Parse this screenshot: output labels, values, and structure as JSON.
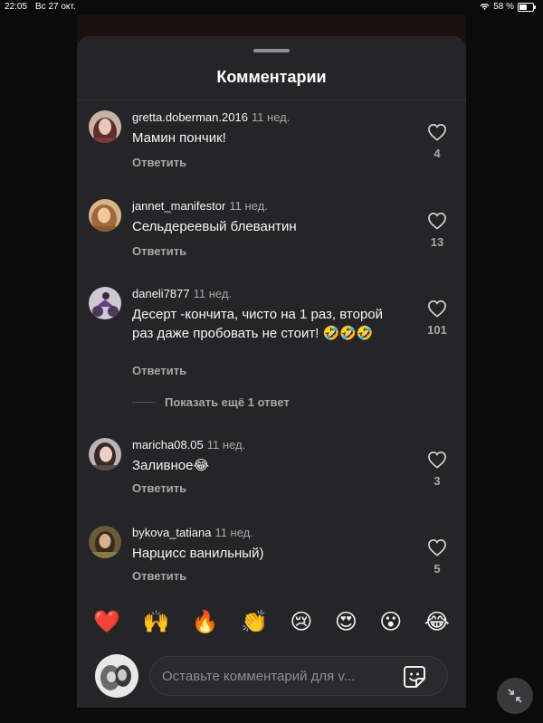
{
  "status_bar": {
    "time": "22:05",
    "date": "Вс 27 окт.",
    "battery": "58 %",
    "battery_level": 0.58
  },
  "sheet": {
    "title": "Комментарии"
  },
  "comments": [
    {
      "user": "gretta.doberman.2016",
      "time": "11 нед.",
      "text": "Мамин  пончик!",
      "reply_label": "Ответить",
      "likes": "4"
    },
    {
      "user": "jannet_manifestor",
      "time": "11 нед.",
      "text": "Сельдереевый блевантин",
      "reply_label": "Ответить",
      "likes": "13"
    },
    {
      "user": "daneli7877",
      "time": "11 нед.",
      "text": "Десерт -кончита, чисто на 1 раз, второй раз даже пробовать не стоит! 🤣🤣🤣",
      "reply_label": "Ответить",
      "likes": "101"
    },
    {
      "user": "maricha08.05",
      "time": "11 нед.",
      "text": "Заливное😂",
      "reply_label": "Ответить",
      "likes": "3"
    },
    {
      "user": "bykova_tatiana",
      "time": "11 нед.",
      "text": "Нарцисс ванильный)",
      "reply_label": "Ответить",
      "likes": "5"
    }
  ],
  "more_replies_label": "Показать ещё 1 ответ",
  "emoji_bar": [
    "❤️",
    "🙌",
    "🔥",
    "👏",
    "😢",
    "😍",
    "😮",
    "😂"
  ],
  "composer": {
    "placeholder": "Оставьте комментарий для v..."
  },
  "icons": {
    "like": "heart-outline-icon",
    "sticker": "sticker-icon",
    "collapse": "collapse-arrows-icon",
    "wifi": "wifi-icon",
    "battery": "battery-icon"
  }
}
